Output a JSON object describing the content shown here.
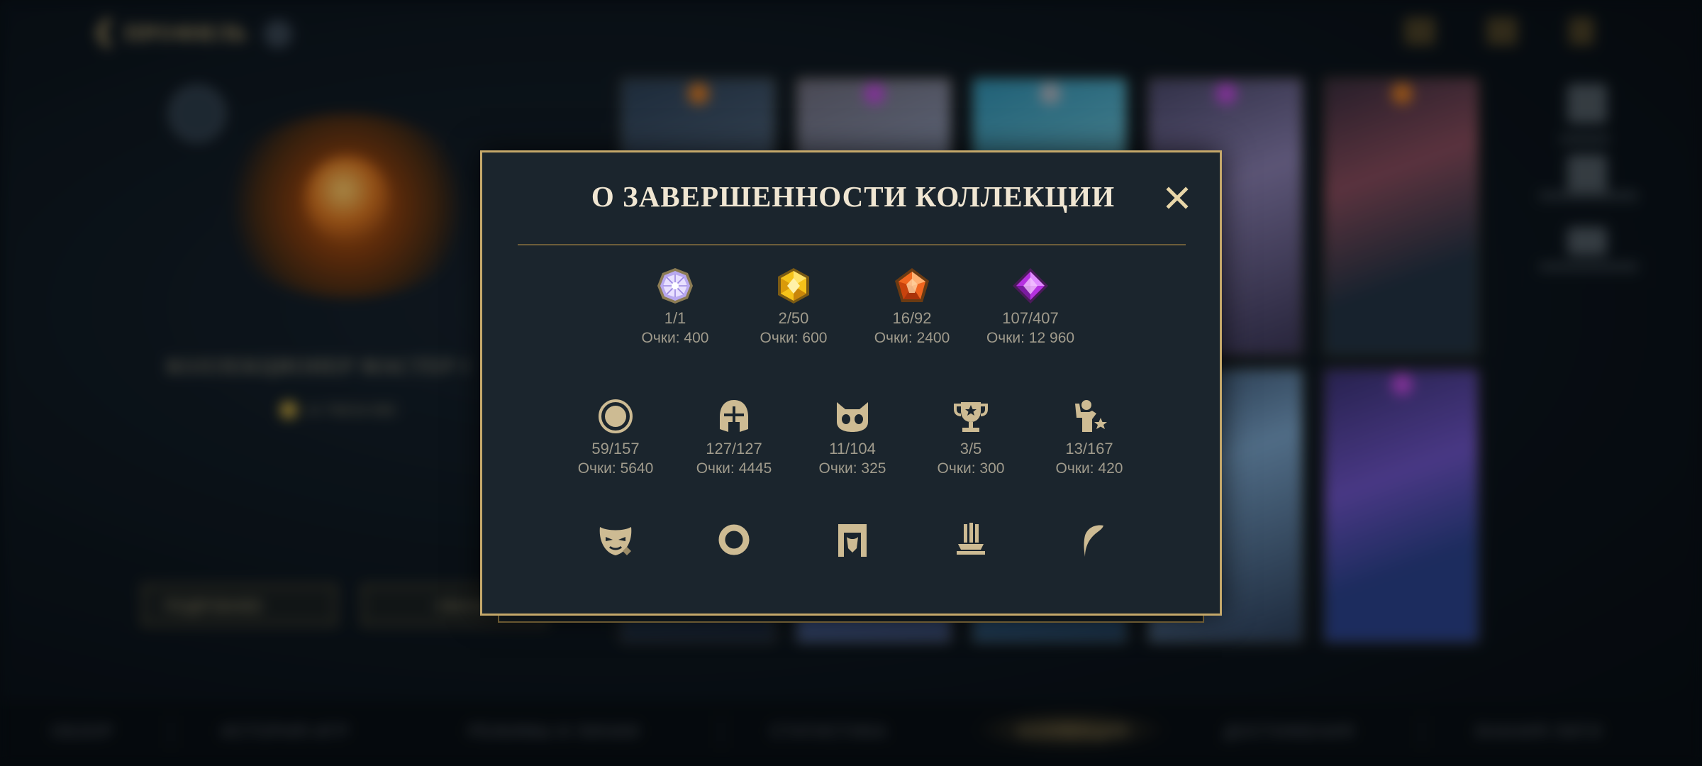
{
  "background": {
    "back_label": "ПРОФИЛЬ",
    "rank_title": "КОЛЛЕКЦИОНЕР МАСТЕР I",
    "rank_sub": "14 700/16 800",
    "buttons": [
      "ПОДРОБНЕЕ",
      "ОБНОВИТЬ"
    ],
    "nav_items": [
      "ОБЗОР",
      "ИСТОРИЯ ИГР",
      "РЕЖИМЫ И ЛИНИИ",
      "СТАТИСТИКА",
      "КОЛЛЕКЦИЯ",
      "ДОСТИЖЕНИЯ",
      "ЗНАНИЯ ЛИГИ"
    ]
  },
  "modal": {
    "title": "О ЗАВЕРШЕННОСТИ КОЛЛЕКЦИИ",
    "close_icon": "close-icon",
    "accent": "#c5a86a",
    "rarity_row": [
      {
        "icon": "ultimate-gem-icon",
        "count": "1/1",
        "points": "Очки: 400",
        "color": "#c7b4ff"
      },
      {
        "icon": "mythic-gem-icon",
        "count": "2/50",
        "points": "Очки: 600",
        "color": "#f2c21e"
      },
      {
        "icon": "legendary-gem-icon",
        "count": "16/92",
        "points": "Очки: 2400",
        "color": "#f0651e"
      },
      {
        "icon": "epic-gem-icon",
        "count": "107/407",
        "points": "Очки: 12 960",
        "color": "#b531e0"
      }
    ],
    "category_row": [
      {
        "icon": "skin-circle-icon",
        "count": "59/157",
        "points": "Очки: 5640"
      },
      {
        "icon": "champion-helmet-icon",
        "count": "127/127",
        "points": "Очки: 4445"
      },
      {
        "icon": "ward-creature-icon",
        "count": "11/104",
        "points": "Очки: 325"
      },
      {
        "icon": "trophy-icon",
        "count": "3/5",
        "points": "Очки: 300"
      },
      {
        "icon": "emote-icon",
        "count": "13/167",
        "points": "Очки: 420"
      }
    ],
    "partial_row": [
      {
        "icon": "chroma-mask-icon"
      },
      {
        "icon": "summoner-ring-icon"
      },
      {
        "icon": "banner-frame-icon"
      },
      {
        "icon": "pedestal-icon"
      },
      {
        "icon": "crest-feather-icon"
      }
    ]
  }
}
